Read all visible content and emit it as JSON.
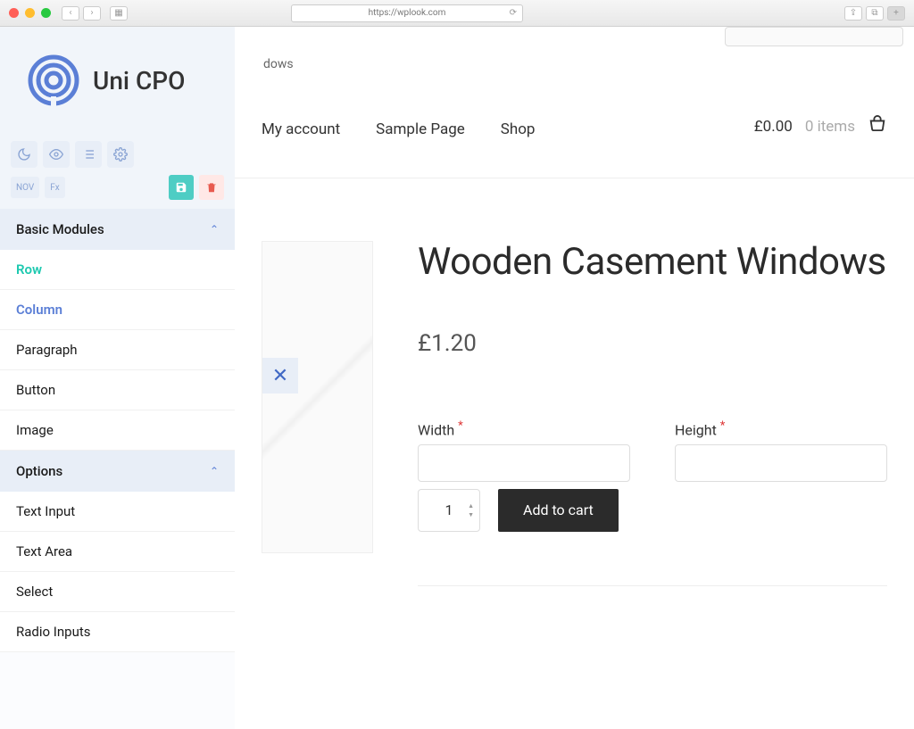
{
  "browser": {
    "url": "https://wplook.com"
  },
  "logo": {
    "text": "Uni CPO"
  },
  "toolbar": {
    "tags": [
      "NOV",
      "Fx"
    ]
  },
  "sidebar": {
    "sections": [
      {
        "title": "Basic Modules",
        "items": [
          "Row",
          "Column",
          "Paragraph",
          "Button",
          "Image"
        ]
      },
      {
        "title": "Options",
        "items": [
          "Text Input",
          "Text Area",
          "Select",
          "Radio Inputs"
        ]
      }
    ]
  },
  "nav": {
    "links": [
      "My account",
      "Sample Page",
      "Shop"
    ],
    "cart_price": "£0.00",
    "cart_items": "0 items"
  },
  "breadcrumb_fragment": "dows",
  "product": {
    "title": "Wooden Casement Windows",
    "price": "£1.20",
    "options": {
      "width_label": "Width",
      "height_label": "Height"
    },
    "qty": "1",
    "add_to_cart": "Add to cart"
  }
}
